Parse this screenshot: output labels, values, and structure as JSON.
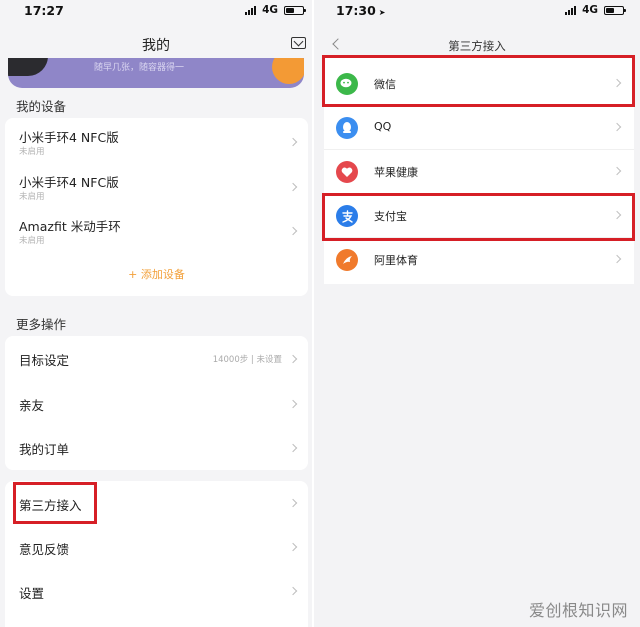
{
  "left": {
    "status": {
      "time": "17:27",
      "network": "4G"
    },
    "title": "我的",
    "banner_text": "随早几张，随容器得一",
    "my_devices": {
      "header": "我的设备",
      "items": [
        {
          "name": "小米手环4 NFC版",
          "status": "未启用"
        },
        {
          "name": "小米手环4 NFC版",
          "status": "未启用"
        },
        {
          "name": "Amazfit 米动手环",
          "status": "未启用"
        }
      ],
      "add_label": "+ 添加设备"
    },
    "more_actions": {
      "header": "更多操作",
      "items": [
        {
          "label": "目标设定",
          "value": "14000步 | 未设置"
        },
        {
          "label": "亲友",
          "value": ""
        },
        {
          "label": "我的订单",
          "value": ""
        }
      ]
    },
    "third_group": {
      "items": [
        {
          "label": "第三方接入"
        },
        {
          "label": "意见反馈"
        },
        {
          "label": "设置"
        }
      ]
    }
  },
  "right": {
    "status": {
      "time": "17:30",
      "network": "4G"
    },
    "title": "第三方接入",
    "items": [
      {
        "label": "微信",
        "icon": "wechat-icon",
        "color": "#3cb84a",
        "glyph": "●"
      },
      {
        "label": "QQ",
        "icon": "qq-icon",
        "color": "#3b8ef0",
        "glyph": "◆"
      },
      {
        "label": "苹果健康",
        "icon": "apple-health-icon",
        "color": "#e5484d",
        "glyph": "♥"
      },
      {
        "label": "支付宝",
        "icon": "alipay-icon",
        "color": "#2b7de9",
        "glyph": "支"
      },
      {
        "label": "阿里体育",
        "icon": "ali-sports-icon",
        "color": "#f07a2c",
        "glyph": "➶"
      }
    ]
  },
  "colors": {
    "highlight": "#d61f26",
    "accent": "#f2a03a",
    "banner": "#8f86c8"
  },
  "watermark": "爱创根知识网"
}
